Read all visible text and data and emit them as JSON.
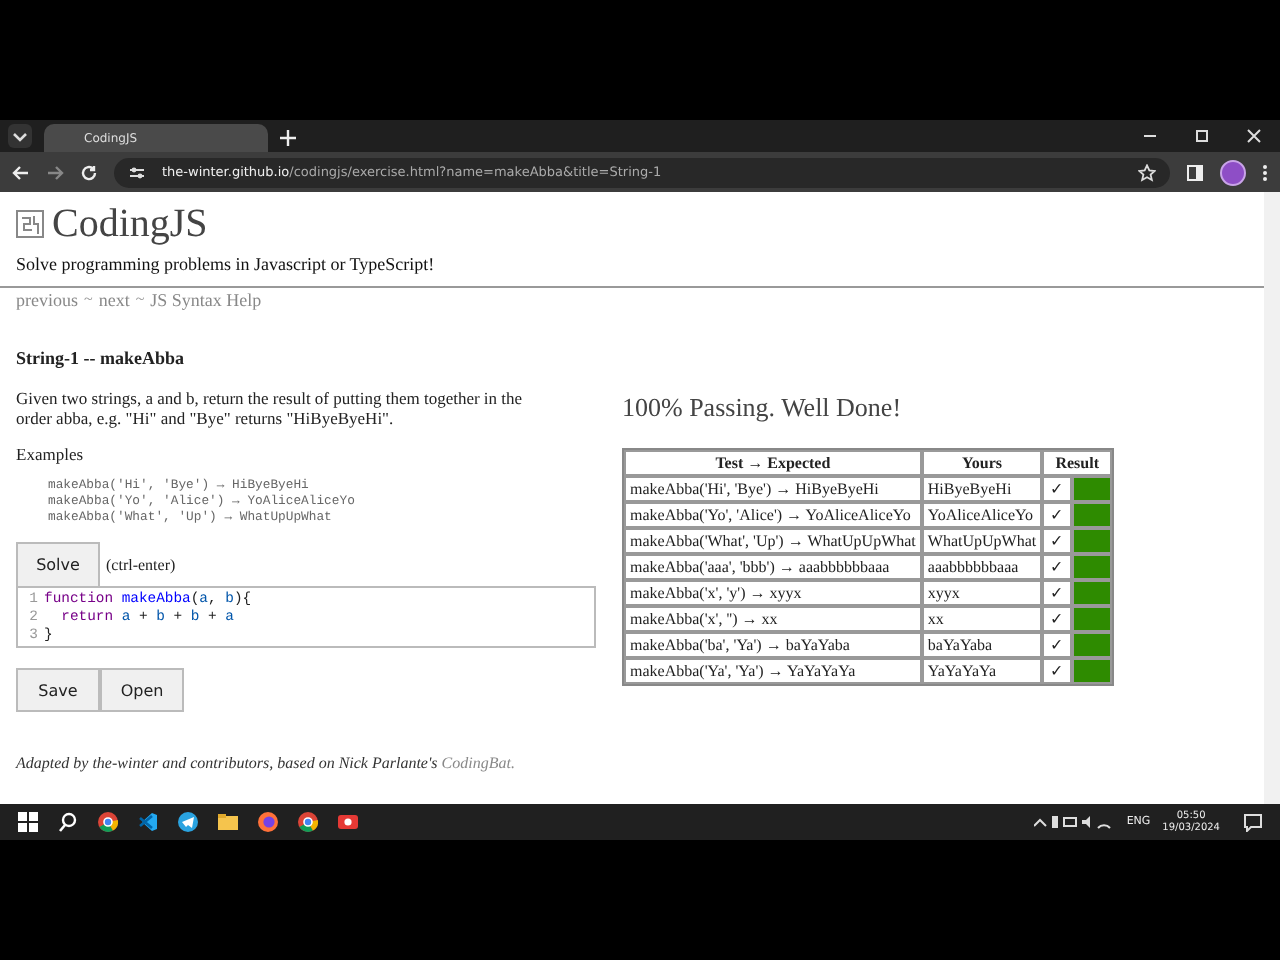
{
  "browser": {
    "tabs": [
      {
        "label": "CodingJS",
        "selected": true
      }
    ],
    "url_host": "the-winter.github.io",
    "url_path": "/codingjs/exercise.html?name=makeAbba&title=String-1"
  },
  "page": {
    "site_title": "CodingJS",
    "tagline": "Solve programming problems in Javascript or TypeScript!",
    "nav": [
      {
        "label": "previous"
      },
      {
        "label": "~",
        "kind": "sep"
      },
      {
        "label": "next"
      },
      {
        "label": "~",
        "kind": "sep"
      },
      {
        "label": "JS Syntax Help"
      }
    ],
    "problem_title": "String-1 -- makeAbba",
    "description": "Given two strings, a and b, return the result of putting them together in the order abba, e.g. \"Hi\" and \"Bye\" returns \"HiByeByeHi\".",
    "examples_label": "Examples",
    "examples": [
      "makeAbba('Hi', 'Bye') → HiByeByeHi",
      "makeAbba('Yo', 'Alice') → YoAliceAliceYo",
      "makeAbba('What', 'Up') → WhatUpUpWhat"
    ],
    "solve_button": "Solve",
    "solve_hint": "(ctrl-enter)",
    "code_lines": [
      {
        "number": "1",
        "tokens": [
          {
            "kind": "keyword",
            "text": "function"
          },
          {
            "kind": "def",
            "text": " makeAbba"
          },
          {
            "kind": "plain",
            "text": "("
          },
          {
            "kind": "var",
            "text": "a"
          },
          {
            "kind": "plain",
            "text": ", "
          },
          {
            "kind": "var",
            "text": "b"
          },
          {
            "kind": "plain",
            "text": "){"
          }
        ]
      },
      {
        "number": "2",
        "tokens": [
          {
            "kind": "keyword",
            "text": "  return"
          },
          {
            "kind": "var",
            "text": " a"
          },
          {
            "kind": "plain",
            "text": " + "
          },
          {
            "kind": "var",
            "text": "b"
          },
          {
            "kind": "plain",
            "text": " + "
          },
          {
            "kind": "var",
            "text": "b"
          },
          {
            "kind": "plain",
            "text": " + "
          },
          {
            "kind": "var",
            "text": "a"
          }
        ]
      },
      {
        "number": "3",
        "tokens": [
          {
            "kind": "plain",
            "text": "}"
          }
        ]
      }
    ],
    "buttons": [
      "Save",
      "Open"
    ],
    "footer": "Adapted by the-winter and contributors, based on Nick Parlante's ",
    "footer_link": "CodingBat.",
    "result_heading": "100% Passing. Well Done!",
    "table": {
      "columns": [
        "Test → Expected",
        "Yours",
        "Result"
      ],
      "rows": [
        {
          "test": "makeAbba('Hi', 'Bye') → HiByeByeHi",
          "yours": "HiByeByeHi",
          "mark": "✓",
          "passed": true
        },
        {
          "test": "makeAbba('Yo', 'Alice') → YoAliceAliceYo",
          "yours": "YoAliceAliceYo",
          "mark": "✓",
          "passed": true
        },
        {
          "test": "makeAbba('What', 'Up') → WhatUpUpWhat",
          "yours": "WhatUpUpWhat",
          "mark": "✓",
          "passed": true
        },
        {
          "test": "makeAbba('aaa', 'bbb') → aaabbbbbbaaa",
          "yours": "aaabbbbbbaaa",
          "mark": "✓",
          "passed": true
        },
        {
          "test": "makeAbba('x', 'y') → xyyx",
          "yours": "xyyx",
          "mark": "✓",
          "passed": true
        },
        {
          "test": "makeAbba('x', '') → xx",
          "yours": "xx",
          "mark": "✓",
          "passed": true
        },
        {
          "test": "makeAbba('ba', 'Ya') → baYaYaba",
          "yours": "baYaYaba",
          "mark": "✓",
          "passed": true
        },
        {
          "test": "makeAbba('Ya', 'Ya') → YaYaYaYa",
          "yours": "YaYaYaYa",
          "mark": "✓",
          "passed": true
        }
      ]
    }
  },
  "taskbar": {
    "language": "ENG",
    "time": "05:50",
    "date": "19/03/2024"
  }
}
